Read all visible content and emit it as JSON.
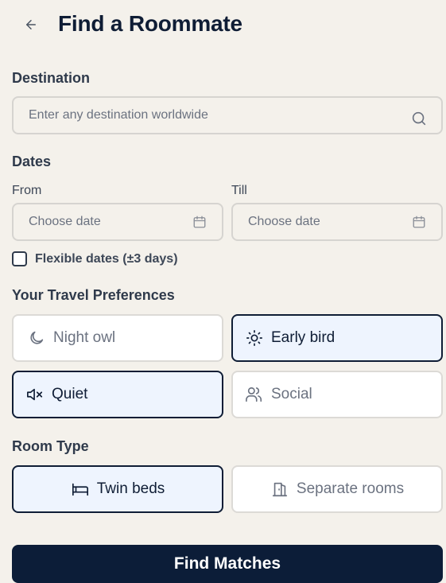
{
  "header": {
    "title": "Find a Roommate",
    "back_icon": "arrow-left-icon"
  },
  "destination": {
    "label": "Destination",
    "placeholder": "Enter any destination worldwide",
    "value": "",
    "icon": "search-icon"
  },
  "dates": {
    "label": "Dates",
    "from_label": "From",
    "till_label": "Till",
    "from_placeholder": "Choose date",
    "till_placeholder": "Choose date",
    "icon": "calendar-icon",
    "flexible": {
      "label": "Flexible dates (±3 days)",
      "checked": false
    }
  },
  "preferences": {
    "label": "Your Travel Preferences",
    "options": [
      {
        "label": "Night owl",
        "icon": "moon-icon",
        "selected": false
      },
      {
        "label": "Early bird",
        "icon": "sun-icon",
        "selected": true
      },
      {
        "label": "Quiet",
        "icon": "volume-mute-icon",
        "selected": true
      },
      {
        "label": "Social",
        "icon": "users-icon",
        "selected": false
      }
    ]
  },
  "room_type": {
    "label": "Room Type",
    "options": [
      {
        "label": "Twin beds",
        "icon": "bed-icon",
        "selected": true
      },
      {
        "label": "Separate rooms",
        "icon": "door-icon",
        "selected": false
      }
    ]
  },
  "cta": {
    "label": "Find Matches"
  },
  "colors": {
    "background": "#f4f1eb",
    "primary": "#0c1d38",
    "selected_bg": "#eef4fe",
    "border": "#d6d4d0"
  }
}
